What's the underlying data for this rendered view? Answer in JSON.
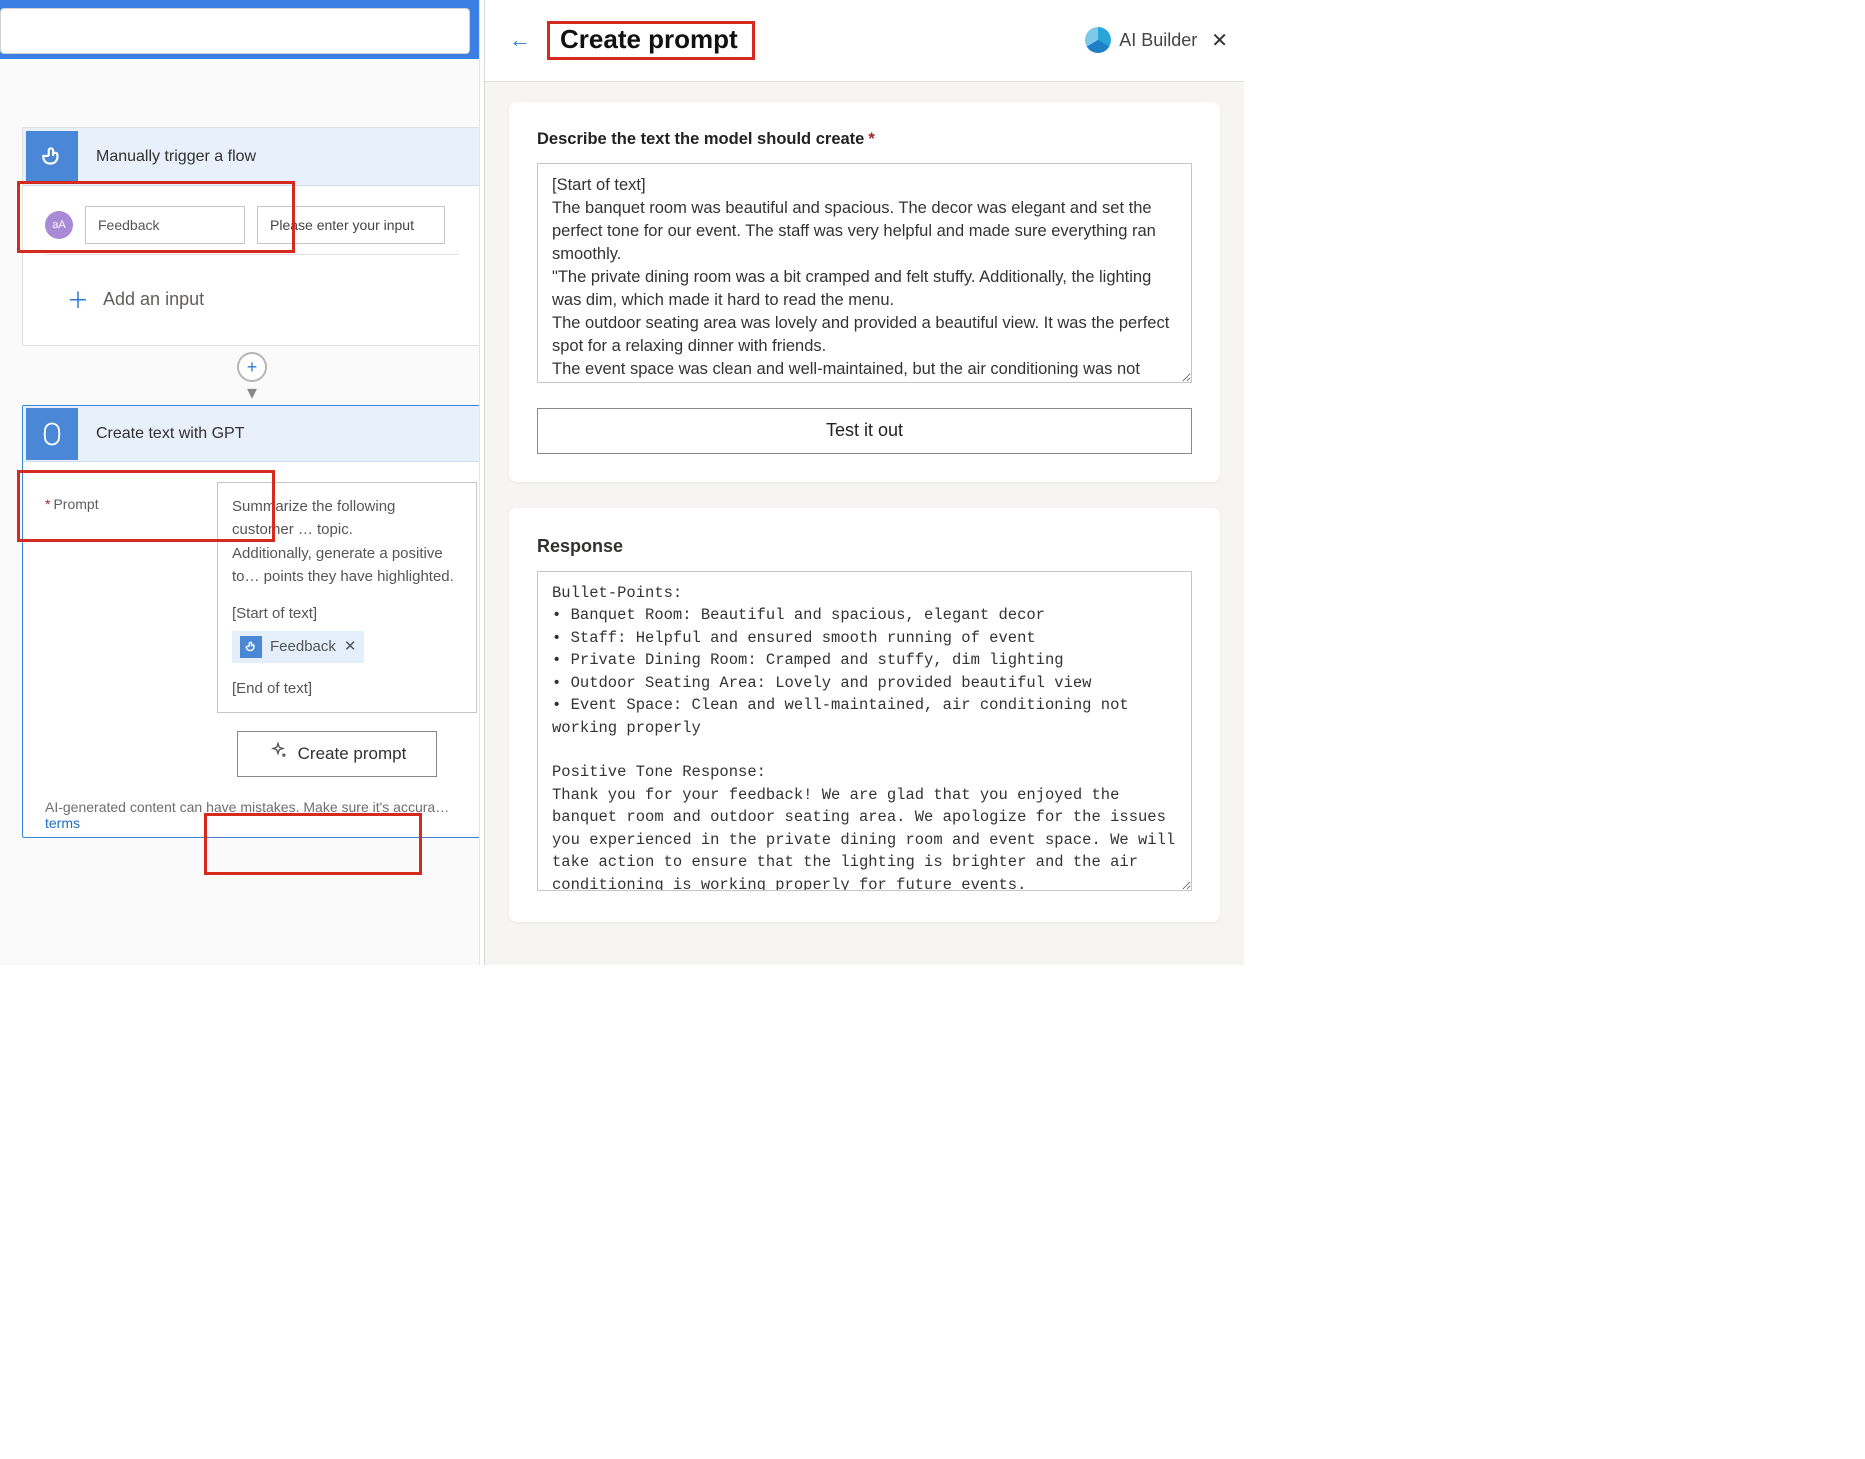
{
  "topbar": {
    "placeholder": ""
  },
  "flow": {
    "trigger": {
      "title": "Manually trigger a flow",
      "avatar_label": "aA",
      "feedback_label": "Feedback",
      "feedback_placeholder": "Please enter your input",
      "add_input_label": "Add an input"
    },
    "action": {
      "title": "Create text with GPT",
      "prompt_field_required": "*",
      "prompt_field_label": "Prompt",
      "prompt_preview": "Summarize the following customer … topic.\nAdditionally, generate a positive to… points they have highlighted.",
      "start_tag": "[Start of text]",
      "end_tag": "[End of text]",
      "chip_label": "Feedback",
      "create_prompt_btn": "Create prompt",
      "disclaimer_text": "AI-generated content can have mistakes. Make sure it's accura…",
      "terms_link": "terms"
    }
  },
  "panel": {
    "title": "Create prompt",
    "brand": "AI Builder",
    "describe_label": "Describe the text the model should create",
    "describe_required": "*",
    "textarea_value": "[Start of text]\nThe banquet room was beautiful and spacious. The decor was elegant and set the perfect tone for our event. The staff was very helpful and made sure everything ran smoothly.\n\"The private dining room was a bit cramped and felt stuffy. Additionally, the lighting was dim, which made it hard to read the menu.\nThe outdoor seating area was lovely and provided a beautiful view. It was the perfect spot for a relaxing dinner with friends.\nThe event space was clean and well-maintained, but the air conditioning was not working properly, so it was uncomfortably warm during our event.",
    "test_btn": "Test it out",
    "response_title": "Response",
    "response_value": "Bullet-Points:\n• Banquet Room: Beautiful and spacious, elegant decor\n• Staff: Helpful and ensured smooth running of event\n• Private Dining Room: Cramped and stuffy, dim lighting\n• Outdoor Seating Area: Lovely and provided beautiful view\n• Event Space: Clean and well-maintained, air conditioning not working properly\n\nPositive Tone Response:\nThank you for your feedback! We are glad that you enjoyed the banquet room and outdoor seating area. We apologize for the issues you experienced in the private dining room and event space. We will take action to ensure that the lighting is brighter and the air conditioning is working properly for future events."
  }
}
